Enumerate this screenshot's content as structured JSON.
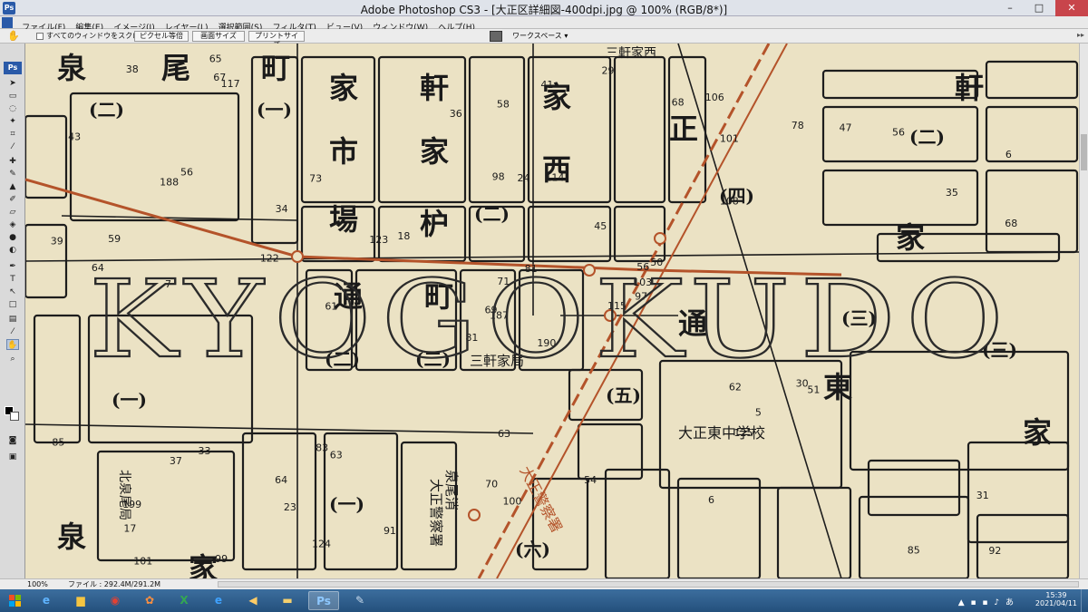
{
  "window": {
    "title": "Adobe Photoshop CS3 - [大正区詳細図-400dpi.jpg @ 100% (RGB/8*)]",
    "controls": [
      "–",
      "□",
      "✕"
    ]
  },
  "menu": [
    "ファイル(F)",
    "編集(E)",
    "イメージ(I)",
    "レイヤー(L)",
    "選択範囲(S)",
    "フィルタ(T)",
    "ビュー(V)",
    "ウィンドウ(W)",
    "ヘルプ(H)"
  ],
  "options_bar": {
    "tool_icon": "hand-tool-icon",
    "scroll_all_label": "すべてのウィンドウをスクロール",
    "buttons": [
      "ピクセル等倍",
      "画面サイズ",
      "プリントサイズ"
    ],
    "workspace_label": "ワークスペース ▾"
  },
  "toolbox": {
    "logo": "Ps",
    "tools": [
      "move-tool",
      "marquee-tool",
      "lasso-tool",
      "magic-wand-tool",
      "crop-tool",
      "slice-tool",
      "healing-brush-tool",
      "brush-tool",
      "clone-stamp-tool",
      "history-brush-tool",
      "eraser-tool",
      "gradient-tool",
      "blur-tool",
      "dodge-tool",
      "pen-tool",
      "type-tool",
      "path-selection-tool",
      "shape-tool",
      "notes-tool",
      "eyedropper-tool",
      "hand-tool",
      "zoom-tool"
    ]
  },
  "map": {
    "large_labels": [
      "泉",
      "尾",
      "町",
      "家",
      "市",
      "場",
      "軒",
      "家",
      "枦",
      "家",
      "西",
      "正",
      "軒",
      "家",
      "通",
      "町",
      "通",
      "東",
      "家",
      "泉",
      "家"
    ],
    "side_labels": [
      "(一)",
      "(二)",
      "(一)",
      "(二)",
      "(四)",
      "(三)",
      "(二)",
      "(二)",
      "(一)",
      "(二)",
      "(五)",
      "(六)",
      "(三)"
    ],
    "street_labels": [
      "三軒家西",
      "三軒家局",
      "大正東中学校",
      "大正警察署",
      "北泉尾局",
      "大正警察署",
      "泉尾消"
    ],
    "watermark": "KYOGOKUDO",
    "numbers": [
      "190",
      "188",
      "187",
      "199",
      "56",
      "63",
      "106",
      "114",
      "101",
      "115",
      "117",
      "92",
      "7",
      "6",
      "81",
      "108",
      "99",
      "98",
      "45",
      "33",
      "18",
      "17",
      "23",
      "24",
      "50",
      "51",
      "56",
      "58",
      "64",
      "62",
      "68",
      "69",
      "70",
      "71",
      "73",
      "78",
      "83",
      "85",
      "31",
      "30",
      "29",
      "123",
      "122",
      "125",
      "124",
      "39",
      "103",
      "101",
      "100",
      "97",
      "37",
      "35",
      "43",
      "5",
      "6",
      "64",
      "67",
      "38",
      "54",
      "56",
      "41",
      "61",
      "59",
      "34",
      "47",
      "65",
      "68",
      "36",
      "81",
      "85",
      "63",
      "91"
    ]
  },
  "status": {
    "zoom": "100%",
    "file": "ファイル : 292.4M/291.2M"
  },
  "taskbar": {
    "apps": [
      "ie-icon",
      "explorer-icon",
      "chrome-icon",
      "paint-icon",
      "excel-icon",
      "edge-icon",
      "speaker-icon",
      "folder-icon",
      "photoshop-icon",
      "brush-icon"
    ],
    "time": "15:39",
    "date": "2021/04/11"
  }
}
